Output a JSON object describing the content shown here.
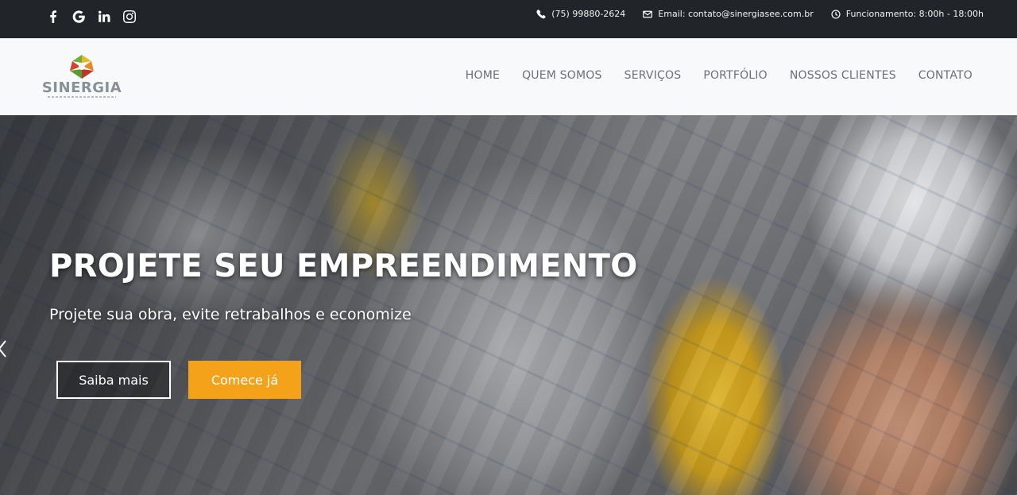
{
  "topbar": {
    "social": [
      {
        "name": "facebook-icon"
      },
      {
        "name": "google-icon"
      },
      {
        "name": "linkedin-icon"
      },
      {
        "name": "instagram-icon"
      }
    ],
    "phone": "(75) 99880-2624",
    "email": "Email: contato@sinergiasee.com.br",
    "hours": "Funcionamento: 8:00h - 18:00h"
  },
  "header": {
    "logo_text": "SINERGIA",
    "nav": [
      "HOME",
      "QUEM SOMOS",
      "SERVIÇOS",
      "PORTFÓLIO",
      "NOSSOS CLIENTES",
      "CONTATO"
    ]
  },
  "hero": {
    "title": "PROJETE SEU EMPREENDIMENTO",
    "subtitle": "Projete sua obra, evite retrabalhos e economize",
    "btn_secondary": "Saiba mais",
    "btn_primary": "Comece já"
  },
  "colors": {
    "topbar_bg": "#212529",
    "header_bg": "#f8f9fa",
    "accent": "#f5a21b",
    "nav_text": "#6c6f74"
  }
}
